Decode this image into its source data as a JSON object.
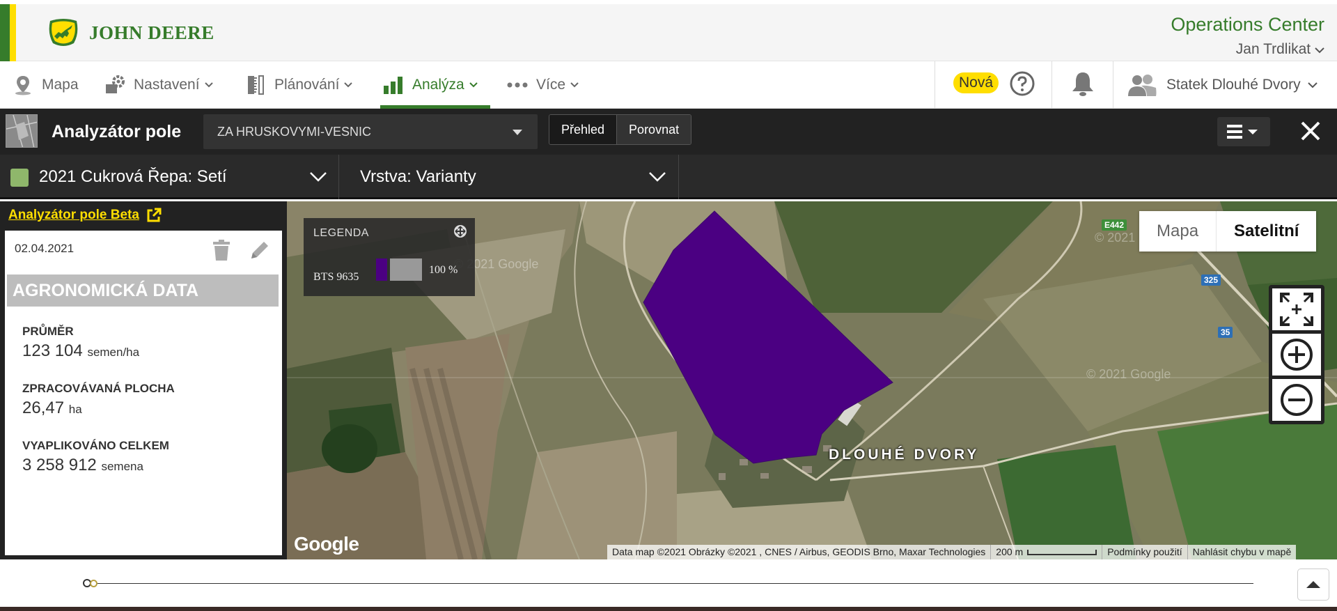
{
  "brand": {
    "name": "JOHN DEERE",
    "app_title": "Operations Center",
    "user": "Jan Trdlikat",
    "colors": {
      "green": "#367c2b",
      "yellow": "#ffde00",
      "field": "#4b0082"
    }
  },
  "nav": {
    "items": [
      {
        "label": "Mapa",
        "icon": "map-pin-icon"
      },
      {
        "label": "Nastavení",
        "icon": "setup-gear-icon"
      },
      {
        "label": "Plánování",
        "icon": "planning-ruler-icon"
      },
      {
        "label": "Analýza",
        "icon": "bar-chart-icon",
        "active": true
      },
      {
        "label": "Více",
        "icon": "more-dots-icon"
      }
    ],
    "badge": "Nová",
    "organization": "Statek Dlouhé Dvory"
  },
  "toolbar": {
    "title": "Analyzátor pole",
    "field": "ZA HRUSKOVYMI-VESNIC",
    "segments": [
      "Přehled",
      "Porovnat"
    ]
  },
  "filters": {
    "crop": "2021 Cukrová Řepa: Setí",
    "layer": "Vrstva: Varianty"
  },
  "panel": {
    "beta_link": "Analyzátor pole Beta",
    "date": "02.04.2021",
    "section_title": "AGRONOMICKÁ DATA",
    "stats": [
      {
        "label": "PRŮMĚR",
        "value": "123 104",
        "unit": "semen/ha"
      },
      {
        "label": "ZPRACOVÁVANÁ PLOCHA",
        "value": "26,47",
        "unit": "ha"
      },
      {
        "label": "VYAPLIKOVÁNO CELKEM",
        "value": "3 258 912",
        "unit": "semena"
      }
    ]
  },
  "map": {
    "legend": {
      "title": "LEGENDA",
      "rows": [
        {
          "label": "BTS 9635",
          "percent": "100 %"
        }
      ]
    },
    "map_types": [
      "Mapa",
      "Satelitní"
    ],
    "active_map_type": "Satelitní",
    "place_label": "DLOUHÉ DVORY",
    "road_labels": [
      "E442",
      "325",
      "35"
    ],
    "watermark": "© 2021 Google",
    "logo": "Google",
    "attribution": "Data map ©2021 Obrázky ©2021 , CNES / Airbus, GEODIS Brno, Maxar Technologies",
    "scale": "200 m",
    "terms": "Podmínky použití",
    "report": "Nahlásit chybu v mapě"
  }
}
